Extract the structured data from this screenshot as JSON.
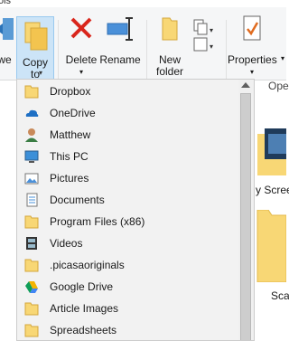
{
  "ribbon": {
    "tab_fragment": "ols",
    "buttons": {
      "move_label_fragment": "we",
      "copy_to_line1": "Copy",
      "copy_to_line2": "to",
      "delete": "Delete",
      "rename": "Rename",
      "new_folder_line1": "New",
      "new_folder_line2": "folder",
      "properties": "Properties",
      "open_fragment": "Ope"
    }
  },
  "copy_to_menu": {
    "items": [
      {
        "label": "Dropbox",
        "icon": "folder-icon"
      },
      {
        "label": "OneDrive",
        "icon": "cloud-icon"
      },
      {
        "label": "Matthew",
        "icon": "user-icon"
      },
      {
        "label": "This PC",
        "icon": "computer-icon"
      },
      {
        "label": "Pictures",
        "icon": "pictures-icon"
      },
      {
        "label": "Documents",
        "icon": "documents-icon"
      },
      {
        "label": "Program Files (x86)",
        "icon": "folder-icon"
      },
      {
        "label": "Videos",
        "icon": "videos-icon"
      },
      {
        "label": ".picasaoriginals",
        "icon": "folder-icon"
      },
      {
        "label": "Google Drive",
        "icon": "google-drive-icon"
      },
      {
        "label": "Article Images",
        "icon": "folder-icon"
      },
      {
        "label": "Spreadsheets",
        "icon": "folder-icon"
      }
    ]
  },
  "pane": {
    "item1_label": "y Scree",
    "item2_label": "Sca"
  },
  "colors": {
    "ribbon_bg": "#f5f6f7",
    "selected_button": "#cce4f7",
    "folder_yellow": "#f8d775",
    "delete_red": "#d9261c",
    "menu_bg": "#f2f2f2"
  }
}
